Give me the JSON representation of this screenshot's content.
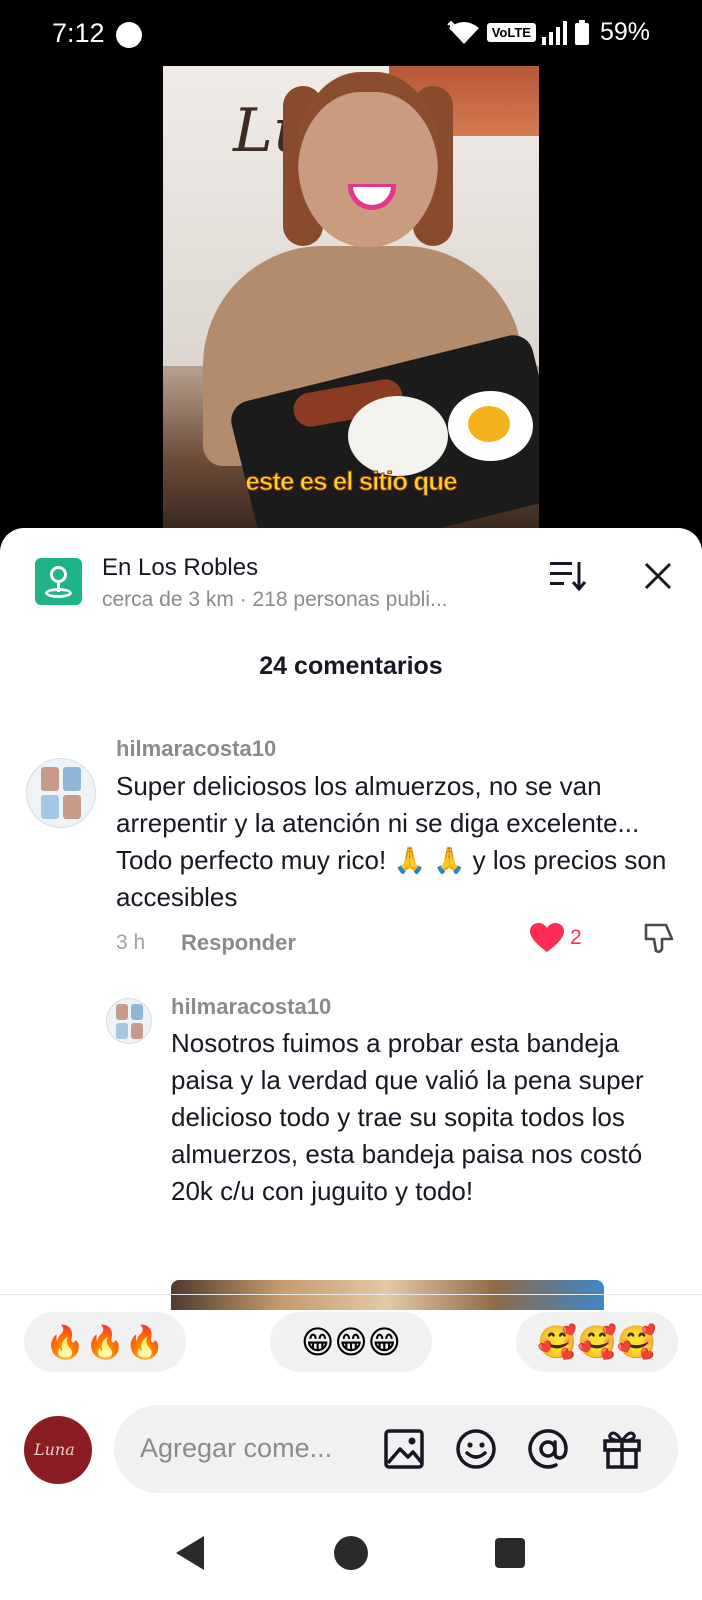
{
  "status_bar": {
    "time": "7:12",
    "network": "VoLTE",
    "battery": "59%"
  },
  "video": {
    "caption": "este es el sitio que"
  },
  "place": {
    "title": "En Los Robles",
    "subtitle": "cerca de 3 km · 218 personas publi..."
  },
  "comments": {
    "count_label": "24 comentarios",
    "items": [
      {
        "username": "hilmaracosta10",
        "text": "Super deliciosos los almuerzos, no se van arrepentir y la atención ni se diga excelente... Todo perfecto muy rico! 🙏 🙏 y los precios son accesibles",
        "time": "3 h",
        "reply_label": "Responder",
        "likes": "2"
      },
      {
        "username": "hilmaracosta10",
        "text": "Nosotros fuimos a probar esta bandeja paisa y la verdad que valió la pena super delicioso todo y trae su sopita todos los almuerzos, esta bandeja paisa nos costó 20k c/u con juguito y todo!"
      }
    ]
  },
  "quick_emojis": [
    "🔥🔥🔥",
    "😁😁😁",
    "🥰🥰🥰"
  ],
  "input": {
    "placeholder": "Agregar come..."
  },
  "colors": {
    "accent": "#fe2c55",
    "place_icon": "#1fb38a",
    "sheet_bg": "#ffffff"
  }
}
